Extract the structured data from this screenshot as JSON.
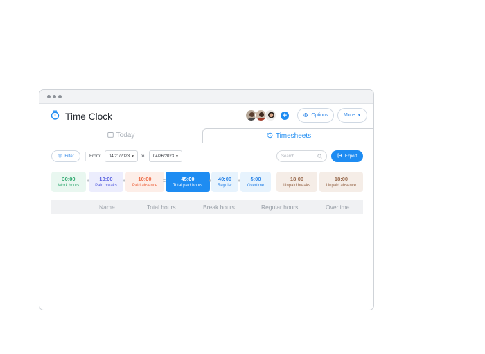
{
  "app": {
    "title": "Time Clock"
  },
  "header": {
    "options_label": "Options",
    "more_label": "More"
  },
  "tabs": {
    "today": "Today",
    "timesheets": "Timesheets",
    "active": "timesheets"
  },
  "toolbar": {
    "filter_label": "Filter",
    "from_label": "From:",
    "from_date": "04/21/2023",
    "to_label": "to:",
    "to_date": "04/26/2023",
    "search_placeholder": "Search",
    "export_label": "Export"
  },
  "stats": [
    {
      "value": "30:00",
      "label": "Work hours"
    },
    {
      "value": "10:00",
      "label": "Paid breaks"
    },
    {
      "value": "10:00",
      "label": "Paid absence"
    },
    {
      "value": "45:00",
      "label": "Total paid hours"
    },
    {
      "value": "40:00",
      "label": "Regular"
    },
    {
      "value": "5:00",
      "label": "Overtime"
    },
    {
      "value": "18:00",
      "label": "Unpaid breaks"
    },
    {
      "value": "18:00",
      "label": "Unpaid absence"
    }
  ],
  "operators": [
    "+",
    "+",
    "=",
    "+",
    "+"
  ],
  "table": {
    "columns": [
      "Name",
      "Total hours",
      "Break hours",
      "Regular hours",
      "Overtime"
    ]
  },
  "colors": {
    "accent": "#1e8cf2"
  }
}
